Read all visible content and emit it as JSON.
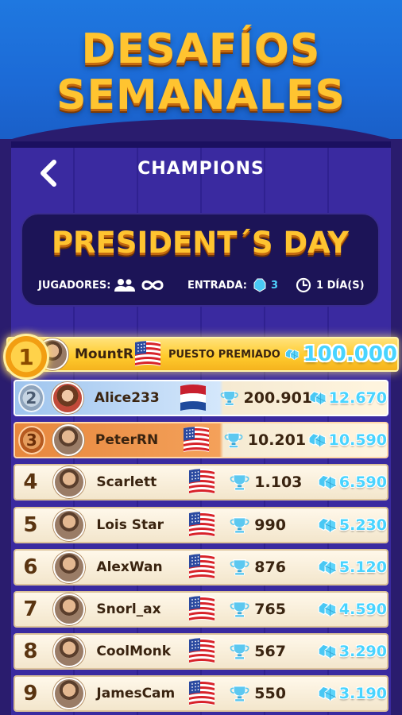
{
  "promo": {
    "title_line1": "DESAFÍOS",
    "title_line2": "SEMANALES"
  },
  "header": {
    "title": "CHAMPIONS",
    "back_icon": "chevron-left-icon"
  },
  "event": {
    "title": "PRESIDENT´S DAY",
    "players_label": "JUGADORES:",
    "players_icon": "users-icon",
    "players_value_icon": "infinity-icon",
    "entry_label": "ENTRADA:",
    "entry_icon": "gem-icon",
    "entry_cost": "3",
    "time_icon": "clock-icon",
    "duration": "1 DÍA(S)"
  },
  "colors": {
    "title_gold": "#ffc430",
    "gem_blue": "#49d4ff",
    "background": "#2a1c6e"
  },
  "leaderboard": {
    "first": {
      "rank": "1",
      "name": "MountR",
      "flag": "us",
      "prize_label": "PUESTO PREMIADO",
      "prize": "100.000"
    },
    "rows": [
      {
        "rank": "2",
        "name": "Alice233",
        "flag": "nl",
        "score": "200.901",
        "reward": "12.670"
      },
      {
        "rank": "3",
        "name": "PeterRN",
        "flag": "us",
        "score": "10.201",
        "reward": "10.590"
      },
      {
        "rank": "4",
        "name": "Scarlett",
        "flag": "us",
        "score": "1.103",
        "reward": "6.590"
      },
      {
        "rank": "5",
        "name": "Lois Star",
        "flag": "us",
        "score": "990",
        "reward": "5.230"
      },
      {
        "rank": "6",
        "name": "AlexWan",
        "flag": "us",
        "score": "876",
        "reward": "5.120"
      },
      {
        "rank": "7",
        "name": "Snorl_ax",
        "flag": "us",
        "score": "765",
        "reward": "4.590"
      },
      {
        "rank": "8",
        "name": "CoolMonk",
        "flag": "us",
        "score": "567",
        "reward": "3.290"
      },
      {
        "rank": "9",
        "name": "JamesCam",
        "flag": "us",
        "score": "550",
        "reward": "3.190"
      }
    ]
  }
}
